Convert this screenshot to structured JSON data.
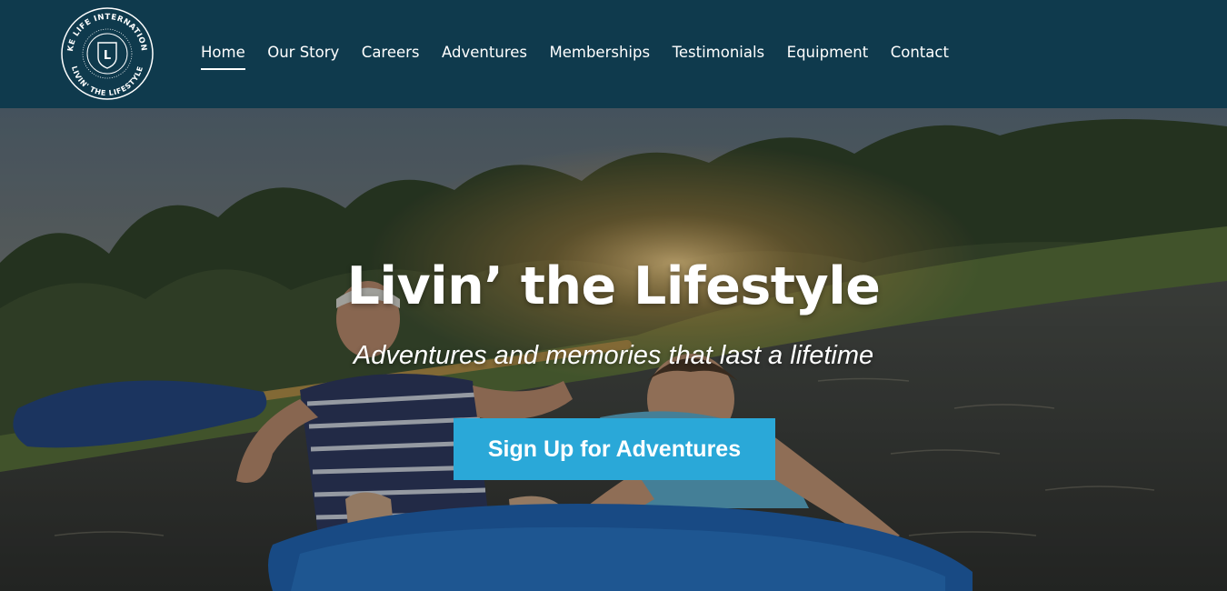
{
  "brand": {
    "ring_text_top": "LAKE LIFE INTERNATIONAL",
    "ring_text_bottom": "LIVIN' THE LIFESTYLE",
    "monogram": "L"
  },
  "nav": {
    "items": [
      {
        "label": "Home",
        "active": true
      },
      {
        "label": "Our Story",
        "active": false
      },
      {
        "label": "Careers",
        "active": false
      },
      {
        "label": "Adventures",
        "active": false
      },
      {
        "label": "Memberships",
        "active": false
      },
      {
        "label": "Testimonials",
        "active": false
      },
      {
        "label": "Equipment",
        "active": false
      },
      {
        "label": "Contact",
        "active": false
      }
    ]
  },
  "hero": {
    "title": "Livin’ the Lifestyle",
    "subtitle": "Adventures and memories that last a lifetime",
    "cta_label": "Sign Up for Adventures"
  },
  "colors": {
    "header_bg": "#0f3a4d",
    "cta_bg": "#2aa8d8",
    "text": "#ffffff"
  }
}
